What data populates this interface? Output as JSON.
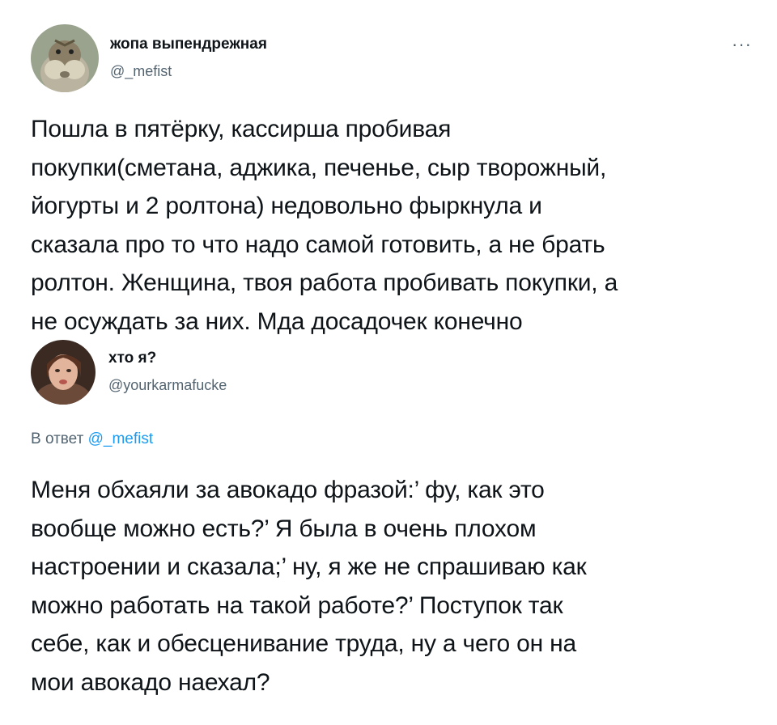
{
  "tweet": {
    "author": {
      "display_name": "жопа выпендрежная",
      "handle": "@_mefist",
      "avatar_icon": "chipmunk-avatar-icon"
    },
    "more_label": "···",
    "text": "Пошла в пятёрку, кассирша пробивая\nпокупки(сметана, аджика, печенье, сыр творожный,\nйогурты и 2 ролтона) недовольно  фыркнула и\nсказала про то что надо самой готовить, а не брать\nролтон. Женщина, твоя работа пробивать покупки, а\nне осуждать   за них. Мда досадочек конечно"
  },
  "reply": {
    "author": {
      "display_name": "хто я?",
      "handle": "@yourkarmafucke",
      "avatar_icon": "person-avatar-icon"
    },
    "reply_prefix": "В ответ",
    "reply_mention": "@_mefist",
    "text": "Меня обхаяли за авокадо фразой:’ фу, как это\nвообще можно есть?’ Я была в очень плохом\nнастроении и сказала;’ ну, я же не спрашиваю как\nможно работать на такой работе?’ Поступок так\nсебе, как и обесценивание труда, ну а чего он на\nмои авокадо наехал?"
  },
  "colors": {
    "text": "#0f1419",
    "secondary": "#536471",
    "accent": "#1d9bf0",
    "background": "#ffffff"
  }
}
